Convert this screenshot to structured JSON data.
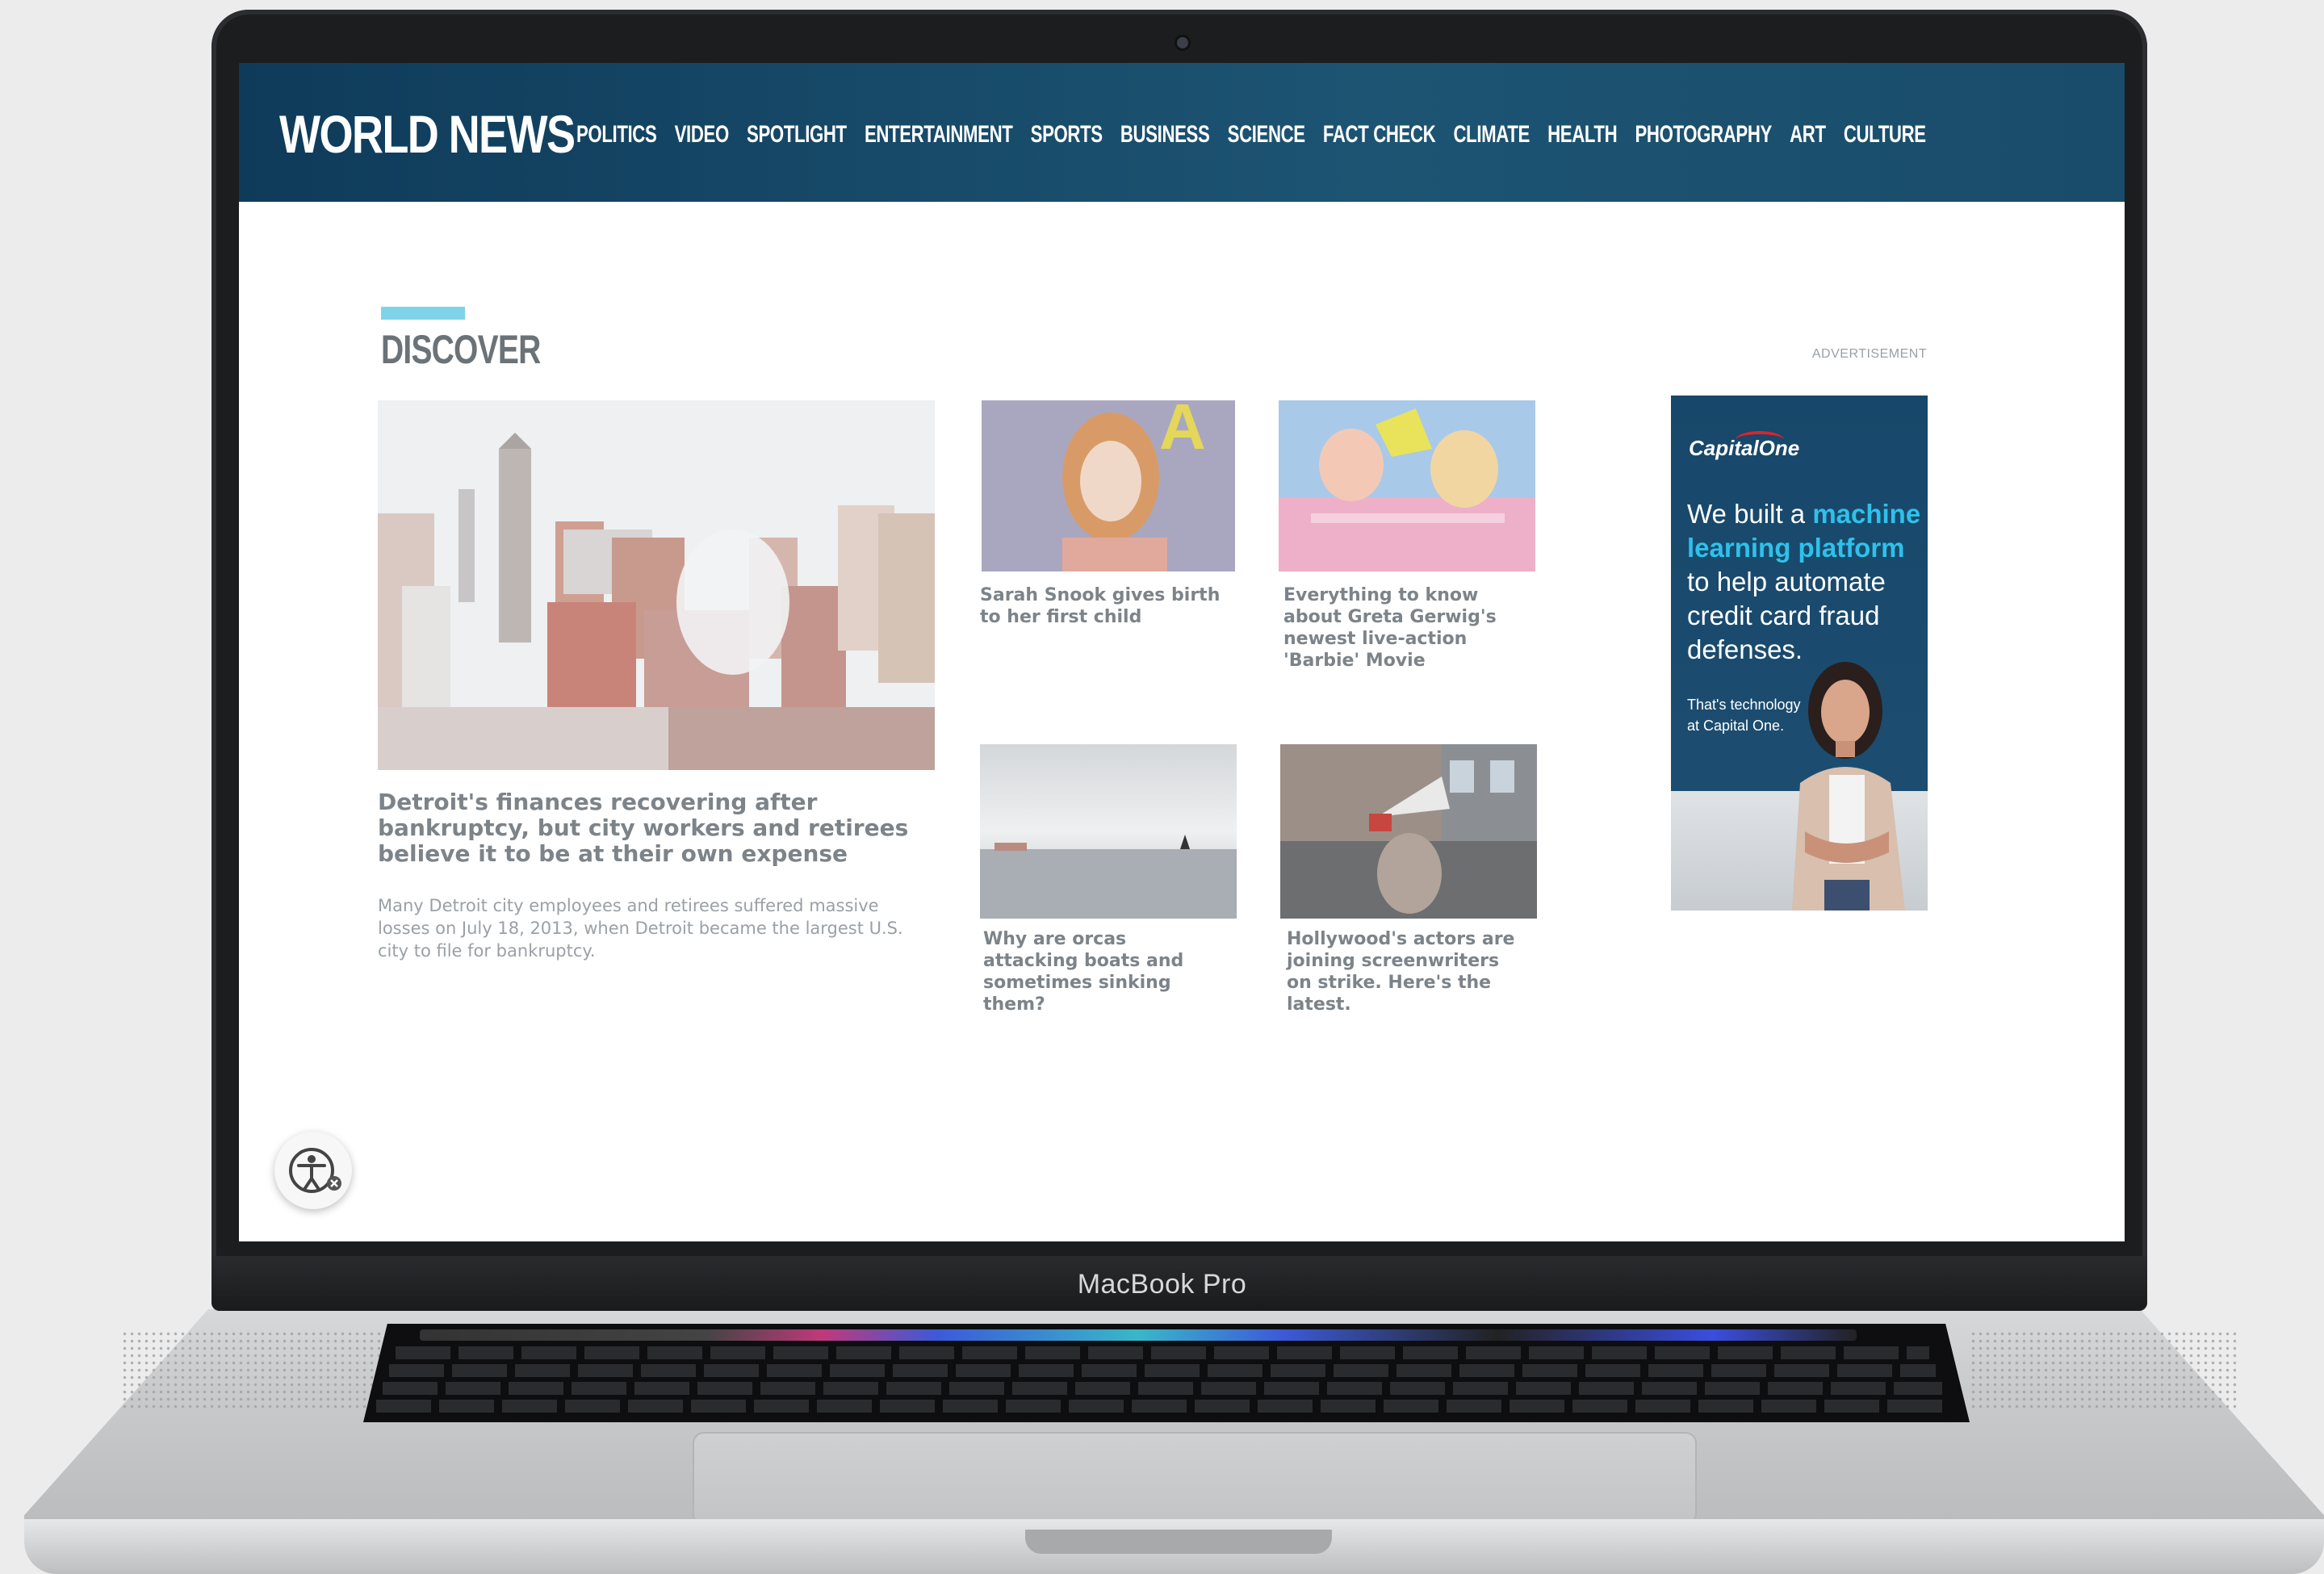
{
  "device": {
    "brand_label": "MacBook Pro"
  },
  "site": {
    "logo": "WORLD NEWS",
    "nav": [
      "POLITICS",
      "VIDEO",
      "SPOTLIGHT",
      "ENTERTAINMENT",
      "SPORTS",
      "BUSINESS",
      "SCIENCE",
      "FACT CHECK",
      "CLIMATE",
      "HEALTH",
      "PHOTOGRAPHY",
      "ART",
      "CULTURE"
    ],
    "header_color": "#1a4a68",
    "accent_color": "#7fd3e8"
  },
  "discover": {
    "title": "DISCOVER",
    "main_story": {
      "headline": "Detroit's finances recovering after bankruptcy, but city workers and retirees believe it to be at their own expense",
      "summary": "Many Detroit city employees and retirees suffered massive losses on July 18, 2013, when Detroit became the largest U.S. city to file for bankruptcy."
    },
    "stories": [
      {
        "headline": "Sarah Snook gives birth to her first child"
      },
      {
        "headline": "Everything to know about Greta Gerwig's newest live-action 'Barbie' Movie"
      },
      {
        "headline": "Why are orcas attacking boats and sometimes sinking them?"
      },
      {
        "headline": "Hollywood's actors are joining screenwriters on strike. Here's the latest."
      }
    ]
  },
  "ad": {
    "label": "ADVERTISEMENT",
    "brand": "CapitalOne",
    "line1": "We built a ",
    "highlight": "machine learning platform",
    "line2": " to help automate credit card fraud defenses.",
    "tagline": "That's technology at Capital One.",
    "highlight_color": "#2ec1ea"
  },
  "icons": {
    "accessibility": "accessibility-icon"
  }
}
